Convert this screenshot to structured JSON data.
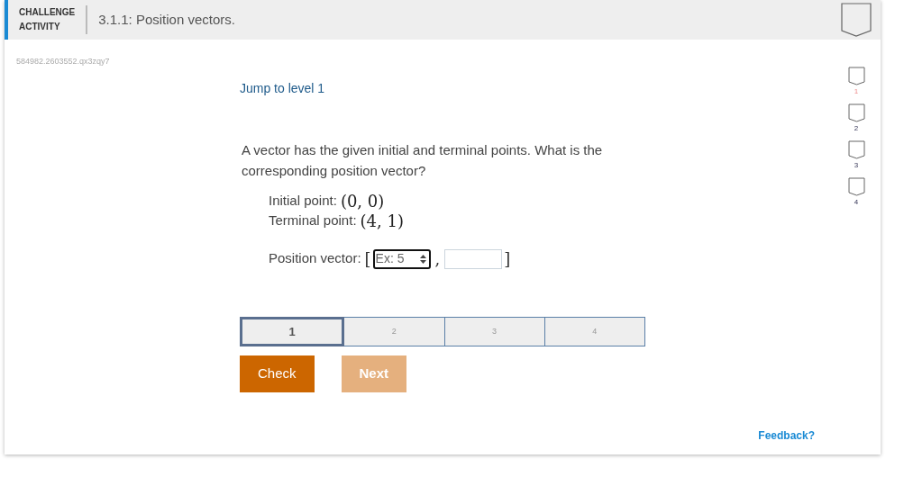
{
  "header": {
    "label_line1": "CHALLENGE",
    "label_line2": "ACTIVITY",
    "title": "3.1.1: Position vectors."
  },
  "activity_id": "584982.2603552.qx3zqy7",
  "jump_link": "Jump to level 1",
  "question": "A vector has the given initial and terminal points. What is the corresponding position vector?",
  "points": [
    {
      "label": "Initial point:",
      "value": "(0, 0)"
    },
    {
      "label": "Terminal point:",
      "value": "(4, 1)"
    }
  ],
  "answer": {
    "label": "Position vector:",
    "open_bracket": "[",
    "first_placeholder": "Ex: 5",
    "comma": ",",
    "close_bracket": "]"
  },
  "levels": [
    {
      "label": "1",
      "selected": true
    },
    {
      "label": "2",
      "selected": false
    },
    {
      "label": "3",
      "selected": false
    },
    {
      "label": "4",
      "selected": false
    }
  ],
  "buttons": [
    {
      "label": "Check",
      "disabled": false
    },
    {
      "label": "Next",
      "disabled": true
    }
  ],
  "level_badges": [
    {
      "label": "1",
      "done": false
    },
    {
      "label": "2",
      "done": false
    },
    {
      "label": "3",
      "done": false
    },
    {
      "label": "4",
      "done": false
    }
  ],
  "feedback_link": "Feedback?"
}
